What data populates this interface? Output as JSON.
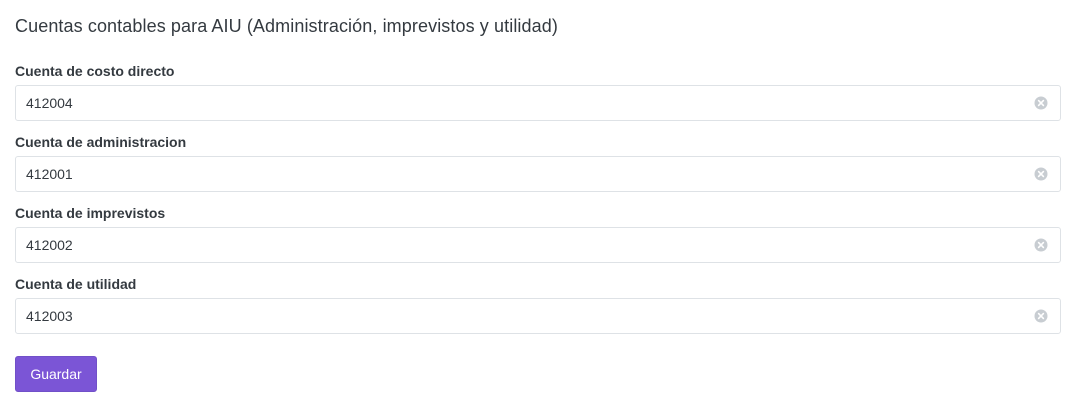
{
  "form": {
    "title": "Cuentas contables para AIU (Administración, imprevistos y utilidad)",
    "fields": [
      {
        "label": "Cuenta de costo directo",
        "value": "412004"
      },
      {
        "label": "Cuenta de administracion",
        "value": "412001"
      },
      {
        "label": "Cuenta de imprevistos",
        "value": "412002"
      },
      {
        "label": "Cuenta de utilidad",
        "value": "412003"
      }
    ],
    "submit_label": "Guardar"
  },
  "colors": {
    "primary_button": "#7b55d6",
    "input_border": "#dee2e6",
    "clear_icon": "#c8cdd2",
    "text": "#343a40"
  },
  "icons": {
    "clear": "x-circle-icon"
  }
}
